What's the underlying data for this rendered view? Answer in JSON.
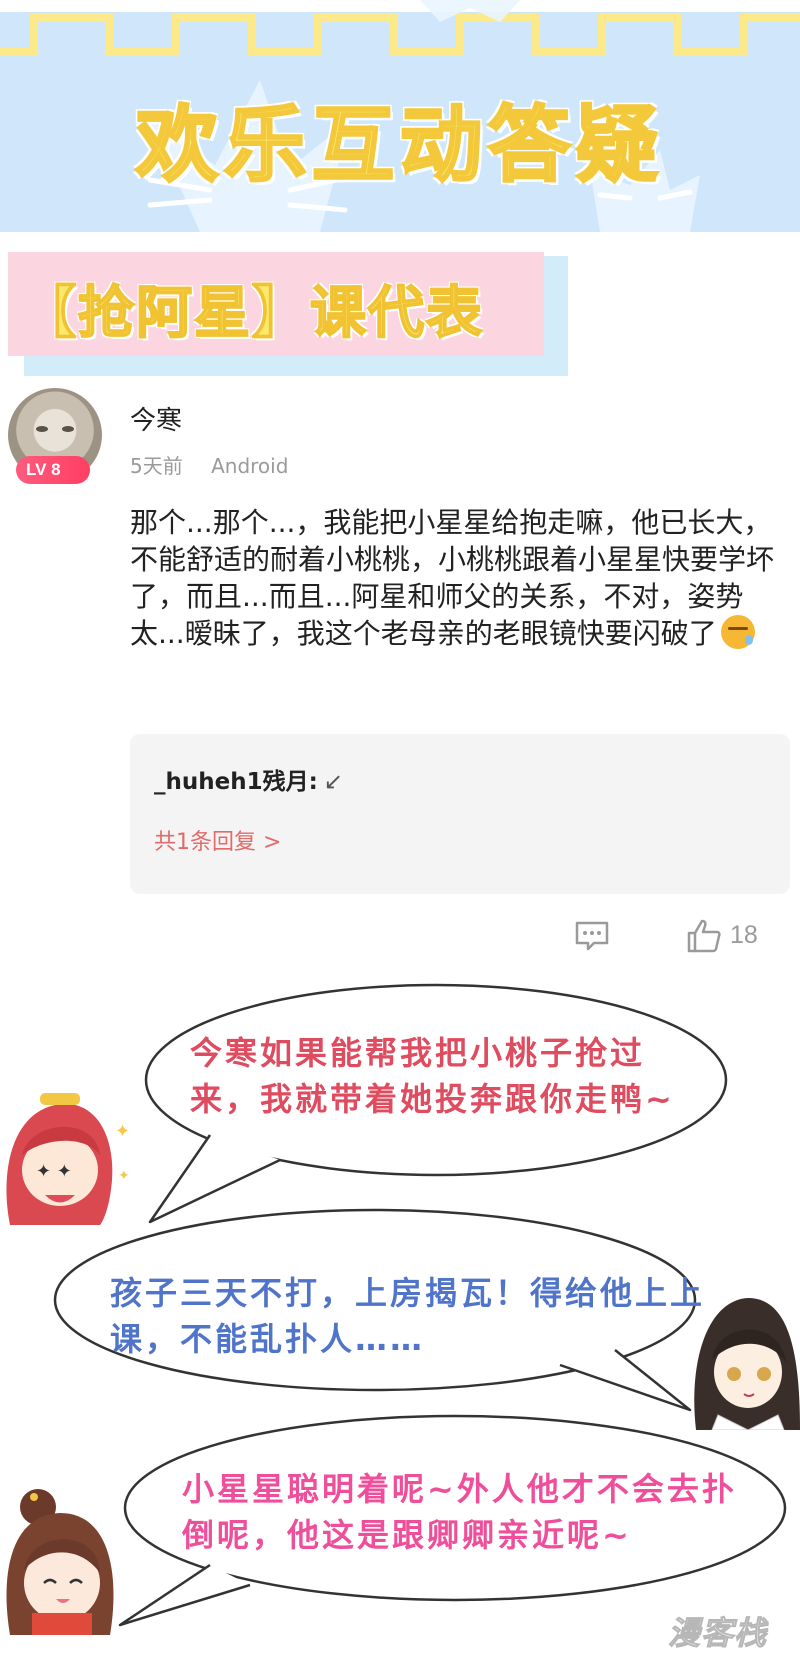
{
  "banner": {
    "title": "欢乐互动答疑"
  },
  "section_tag": {
    "text": "【抢阿星】课代表"
  },
  "comment": {
    "avatar_level": "LV 8",
    "username": "今寒",
    "time": "5天前",
    "platform": "Android",
    "text": "那个...那个...，我能把小星星给抱走嘛，他已长大，不能舒适的耐着小桃桃，小桃桃跟着小星星快要学坏了，而且...而且...阿星和师父的关系，不对，姿势太...暧昧了，我这个老母亲的老眼镜快要闪破了",
    "emoji": "sweat-face-emoji",
    "reply": {
      "author": "_huheh1残月:",
      "arrow": "↙",
      "count_label": "共1条回复 >"
    },
    "likes": "18"
  },
  "bubbles": [
    {
      "text": "今寒如果能帮我把小桃子抢过来，我就带着她投奔跟你走鸭~",
      "color": "#df4b5f"
    },
    {
      "text": "孩子三天不打，上房揭瓦！得给他上上课，不能乱扑人……",
      "color": "#4f74c9"
    },
    {
      "text": "小星星聪明着呢~外人他才不会去扑倒呢，他这是跟卿卿亲近呢~",
      "color": "#ef4f9a"
    }
  ],
  "watermark": "漫客栈",
  "colors": {
    "banner_bg": "#cfe6fb",
    "tag_bg": "#fbd6e0",
    "title_yellow": "#fbe96e",
    "reply_red": "#e26a6a"
  }
}
